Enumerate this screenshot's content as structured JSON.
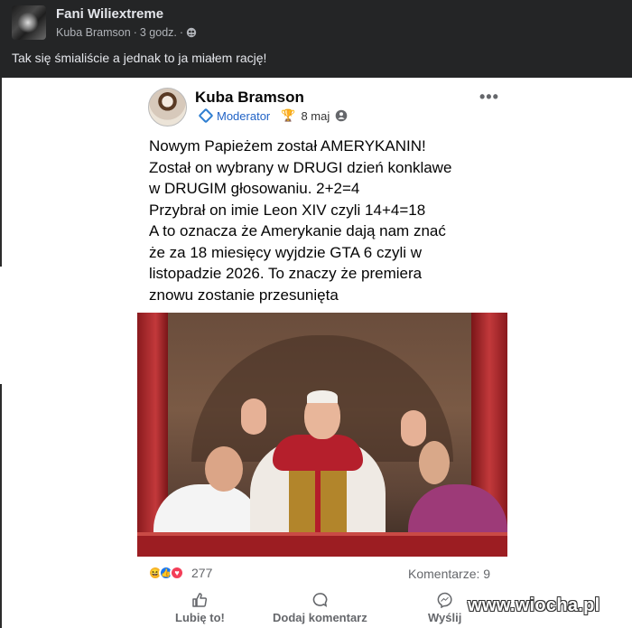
{
  "outer_post": {
    "author": "Fani Wiliextreme",
    "shared_from": "Kuba Bramson",
    "time": "3 godz.",
    "separator": "·",
    "text": "Tak się śmialiście a jednak to ja miałem rację!"
  },
  "inner_post": {
    "author": "Kuba Bramson",
    "role": "Moderator",
    "date": "8 maj",
    "separator": "·",
    "body_lines": [
      "Nowym Papieżem został AMERYKANIN!",
      "Został on wybrany w DRUGI dzień konklawe",
      "w DRUGIM głosowaniu. 2+2=4",
      "Przybrał on imie Leon XIV czyli 14+4=18",
      "A to oznacza że Amerykanie dają nam znać",
      "że za 18 miesięcy wyjdzie GTA 6 czyli w",
      "listopadzie 2026. To znaczy że premiera",
      "znowu zostanie przesunięta"
    ]
  },
  "reactions": {
    "count": "277",
    "types": [
      "haha",
      "like",
      "love"
    ],
    "comments": "Komentarze: 9"
  },
  "actions": {
    "like": "Lubię to!",
    "comment": "Dodaj komentarz",
    "share": "Wyślij"
  },
  "watermark": "www.wiocha.pl",
  "colors": {
    "outer_bg": "#242526",
    "moderator_blue": "#2163c6",
    "like_blue": "#1877f2"
  }
}
